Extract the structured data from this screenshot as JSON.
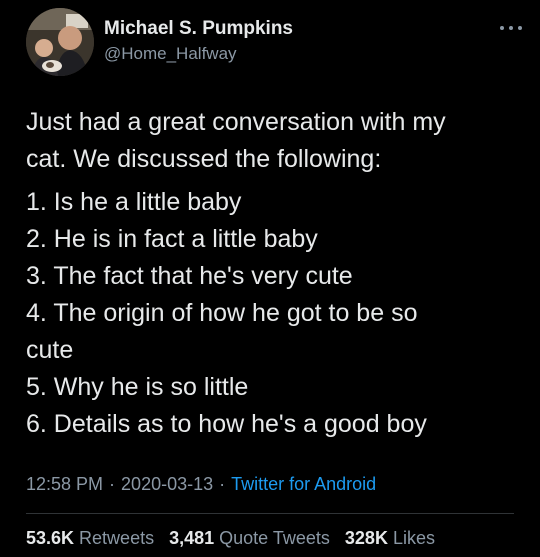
{
  "author": {
    "name": "Michael S. Pumpkins",
    "handle": "@Home_Halfway",
    "avatar_icon": "profile-photo"
  },
  "more_icon": "ellipsis-icon",
  "tweet": {
    "intro_lines": [
      "Just had a great conversation with my",
      "cat. We discussed the following:"
    ],
    "list_lines": [
      "1. Is he a little baby",
      "2. He is in fact a little baby",
      "3. The fact that he's very cute",
      "4. The origin of how he got to be so",
      "cute",
      "5. Why he is so little",
      "6. Details as to how he's a good boy"
    ]
  },
  "meta": {
    "time": "12:58 PM",
    "separator": "·",
    "date": "2020-03-13",
    "source": "Twitter for Android"
  },
  "stats": {
    "retweets_count": "53.6K",
    "retweets_label": "Retweets",
    "quotes_count": "3,481",
    "quotes_label": "Quote Tweets",
    "likes_count": "328K",
    "likes_label": "Likes"
  },
  "colors": {
    "background": "#000000",
    "text": "#e7e9ea",
    "secondary": "#8b98a5",
    "link": "#1d9bf0"
  }
}
